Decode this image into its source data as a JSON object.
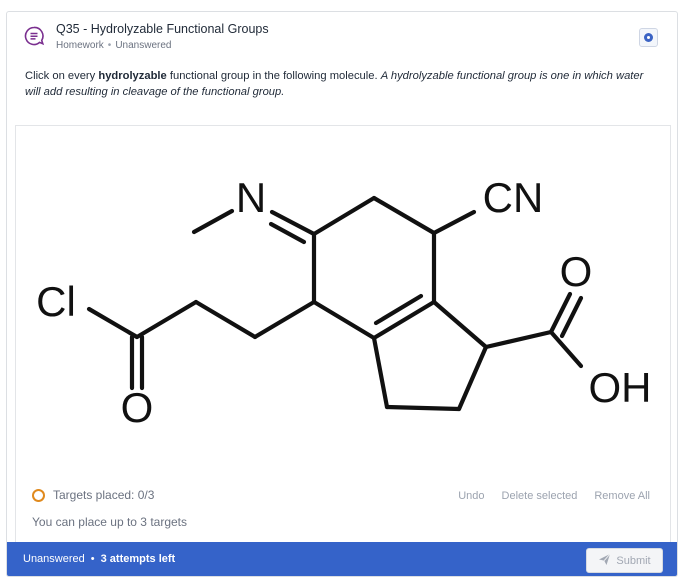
{
  "header": {
    "title": "Q35 - Hydrolyzable Functional Groups",
    "category": "Homework",
    "status": "Unanswered",
    "icon": "question-list-icon",
    "accent_color": "#7a2f8f"
  },
  "prompt": {
    "lead": "Click on every ",
    "emphasis": "hydrolyzable",
    "tail": " functional group in the following molecule. ",
    "definition": "A hydrolyzable functional group is one in which water will add resulting in cleavage of the functional group."
  },
  "molecule": {
    "labels": {
      "nitrogen": "N",
      "nitrile": "CN",
      "chlorine": "Cl",
      "acyl_oxygen": "O",
      "acid_oxygen": "O",
      "hydroxyl": "OH"
    }
  },
  "targets": {
    "placed_text": "Targets placed: 0/3",
    "limit_text": "You can place up to 3 targets",
    "ring_color": "#e08a1e"
  },
  "actions": {
    "undo": "Undo",
    "delete_selected": "Delete selected",
    "remove_all": "Remove All"
  },
  "footer": {
    "status": "Unanswered",
    "attempts": "3 attempts left",
    "submit": "Submit",
    "bar_color": "#3563c9"
  }
}
